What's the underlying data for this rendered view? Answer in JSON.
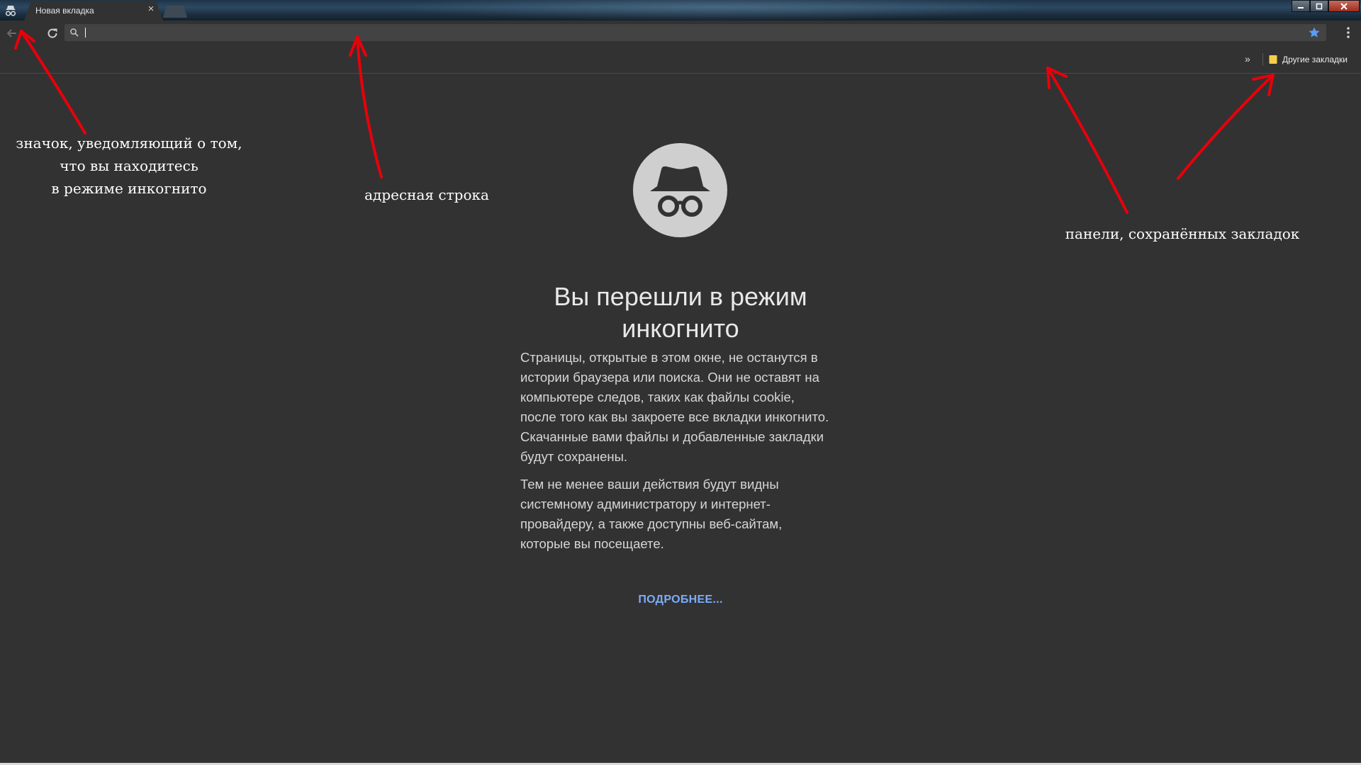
{
  "tab": {
    "title": "Новая вкладка",
    "close_glyph": "×"
  },
  "omnibox": {
    "value": "",
    "placeholder": ""
  },
  "bookmarks_bar": {
    "chevron": "»",
    "other_bookmarks_label": "Другие закладки"
  },
  "ntp": {
    "heading": "Вы перешли в режим инкогнито",
    "paragraph1": "Страницы, открытые в этом окне, не останутся в истории браузера или поиска. Они не оставят на компьютере следов, таких как файлы cookie, после того как вы закроете все вкладки инкогнито. Скачанные вами файлы и добавленные закладки будут сохранены.",
    "paragraph2": "Тем не менее ваши действия будут видны системному администратору и интернет-провайдеру, а также доступны веб-сайтам, которые вы посещаете.",
    "learn_more": "ПОДРОБНЕЕ..."
  },
  "annotations": {
    "incognito_icon_note": [
      "значок, уведомляющий о том,",
      "что вы находитесь",
      "в режиме инкогнито"
    ],
    "address_bar_note": "адресная строка",
    "bookmarks_bar_note": "панели, сохранённых закладок"
  },
  "icons": {
    "incognito_badge": "incognito-icon",
    "back": "back-arrow-icon",
    "reload": "reload-icon",
    "search": "search-icon",
    "star": "star-icon",
    "menu": "kebab-menu-icon",
    "folder": "folder-icon",
    "ntp_emblem": "incognito-spy-icon"
  },
  "colors": {
    "page_background": "#323232",
    "link_blue": "#7cacf8",
    "star_blue": "#5a9cf8",
    "annotation_arrow": "#e8000b",
    "folder_yellow": "#f5cf4c"
  }
}
